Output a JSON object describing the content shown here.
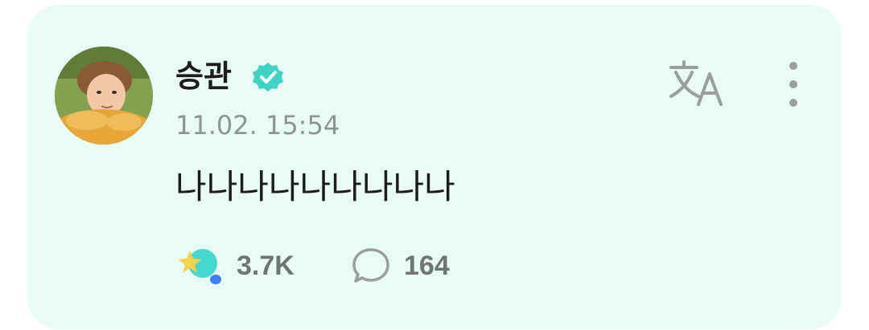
{
  "post": {
    "author_name": "승관",
    "timestamp": "11.02. 15:54",
    "message": "나나나나나나나나나",
    "like_count": "3.7K",
    "comment_count": "164"
  },
  "icons": {
    "verified": "verified-badge-icon",
    "translate": "translate-icon",
    "more": "more-vertical-icon",
    "like": "star-light-icon",
    "comment": "comment-bubble-icon"
  },
  "colors": {
    "card_background": "#e8fbf7",
    "verified_badge": "#3fd3c4",
    "text_primary": "#1c1c1c",
    "text_secondary": "#8e9492",
    "icon_gray": "#9a9e9d"
  }
}
